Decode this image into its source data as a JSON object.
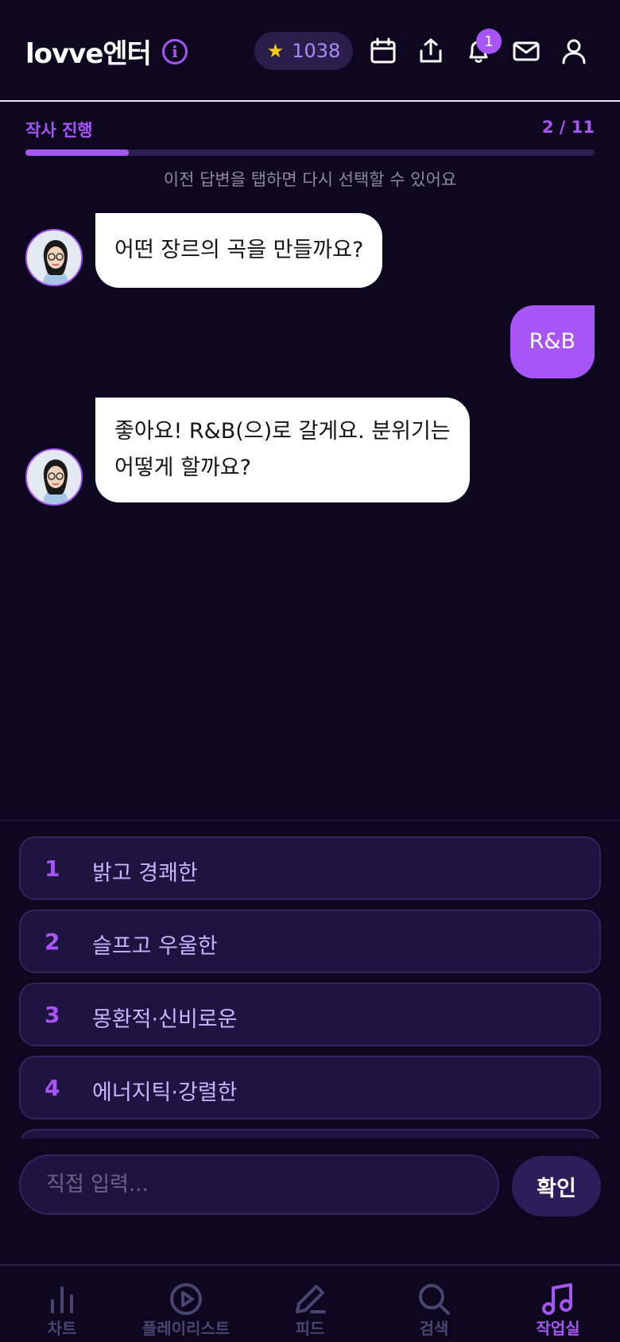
{
  "header": {
    "brand": "lovve엔터",
    "points": "1038",
    "notification_count": "1"
  },
  "progress": {
    "label": "작사 진행",
    "count": "2 / 11",
    "current": 2,
    "total": 11,
    "hint": "이전 답변을 탭하면 다시 선택할 수 있어요"
  },
  "chat": {
    "messages": [
      {
        "role": "bot",
        "text": "어떤 장르의 곡을 만들까요?"
      },
      {
        "role": "user",
        "text": "R&B"
      },
      {
        "role": "bot",
        "line1": "좋아요! R&B(으)로 갈게요. 분위기는",
        "line2": "어떻게 할까요?"
      }
    ]
  },
  "options": [
    {
      "index": "1",
      "label": "밝고 경쾌한"
    },
    {
      "index": "2",
      "label": "슬프고 우울한"
    },
    {
      "index": "3",
      "label": "몽환적·신비로운"
    },
    {
      "index": "4",
      "label": "에너지틱·강렬한"
    }
  ],
  "input": {
    "placeholder": "직접 입력...",
    "value": "",
    "confirm_label": "확인"
  },
  "nav": {
    "items": [
      {
        "label": "차트",
        "icon": "chart-icon"
      },
      {
        "label": "플레이리스트",
        "icon": "play-circle-icon"
      },
      {
        "label": "피드",
        "icon": "pen-icon"
      },
      {
        "label": "검색",
        "icon": "search-icon"
      },
      {
        "label": "작업실",
        "icon": "music-note-icon"
      }
    ],
    "active_index": 4
  },
  "colors": {
    "background": "#0d0820",
    "accent": "#a855f7",
    "option_bg": "#1d1440",
    "star": "#facc15"
  }
}
